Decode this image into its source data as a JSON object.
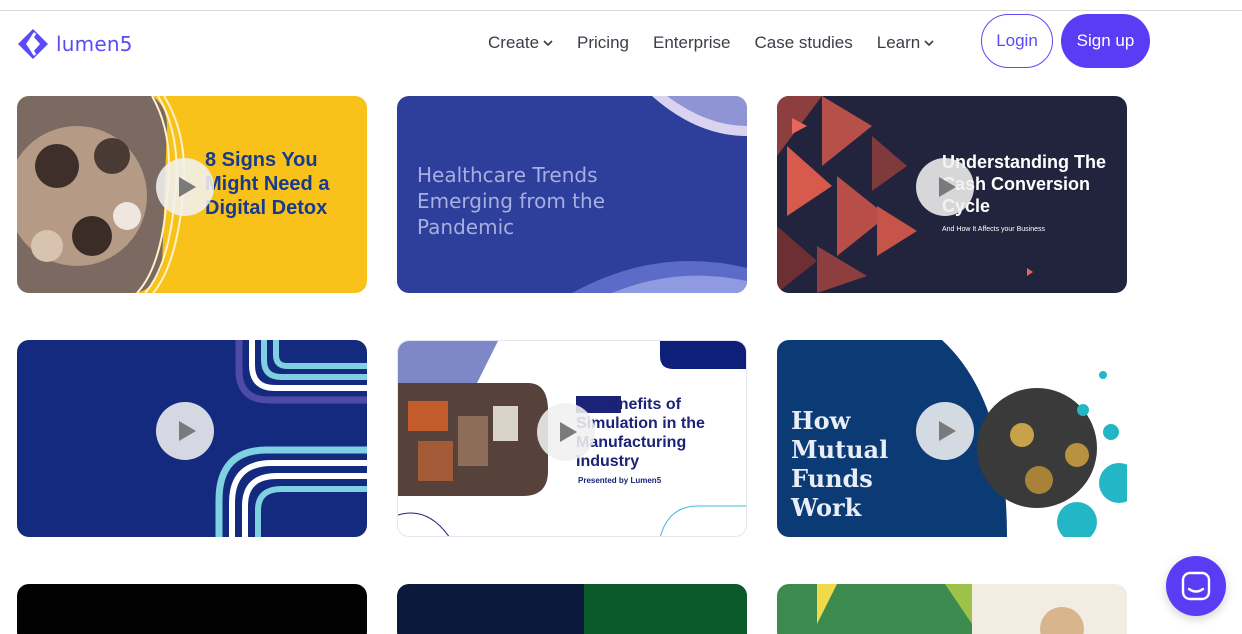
{
  "brand": {
    "name": "lumen5",
    "accent": "#5a4bf5"
  },
  "nav": {
    "items": [
      {
        "label": "Create",
        "dropdown": true
      },
      {
        "label": "Pricing",
        "dropdown": false
      },
      {
        "label": "Enterprise",
        "dropdown": false
      },
      {
        "label": "Case studies",
        "dropdown": false
      },
      {
        "label": "Learn",
        "dropdown": true
      }
    ],
    "login_label": "Login",
    "signup_label": "Sign up"
  },
  "cards": [
    {
      "title": "8 Signs You Might Need a Digital Detox",
      "subtitle": ""
    },
    {
      "title": "Healthcare Trends Emerging from the Pandemic",
      "subtitle": ""
    },
    {
      "title": "Understanding The Cash Conversion Cycle",
      "subtitle": "And How It Affects your Business"
    },
    {
      "title": "",
      "subtitle": ""
    },
    {
      "title": "10 Benefits of Simulation in the Manufacturing Industry",
      "subtitle": "Presented by Lumen5"
    },
    {
      "title": "How Mutual Funds Work",
      "subtitle": ""
    }
  ],
  "icons": {
    "play": "play-icon",
    "chat": "chat-icon",
    "logo": "lumen5-logo-icon",
    "chevron": "chevron-down-icon"
  }
}
